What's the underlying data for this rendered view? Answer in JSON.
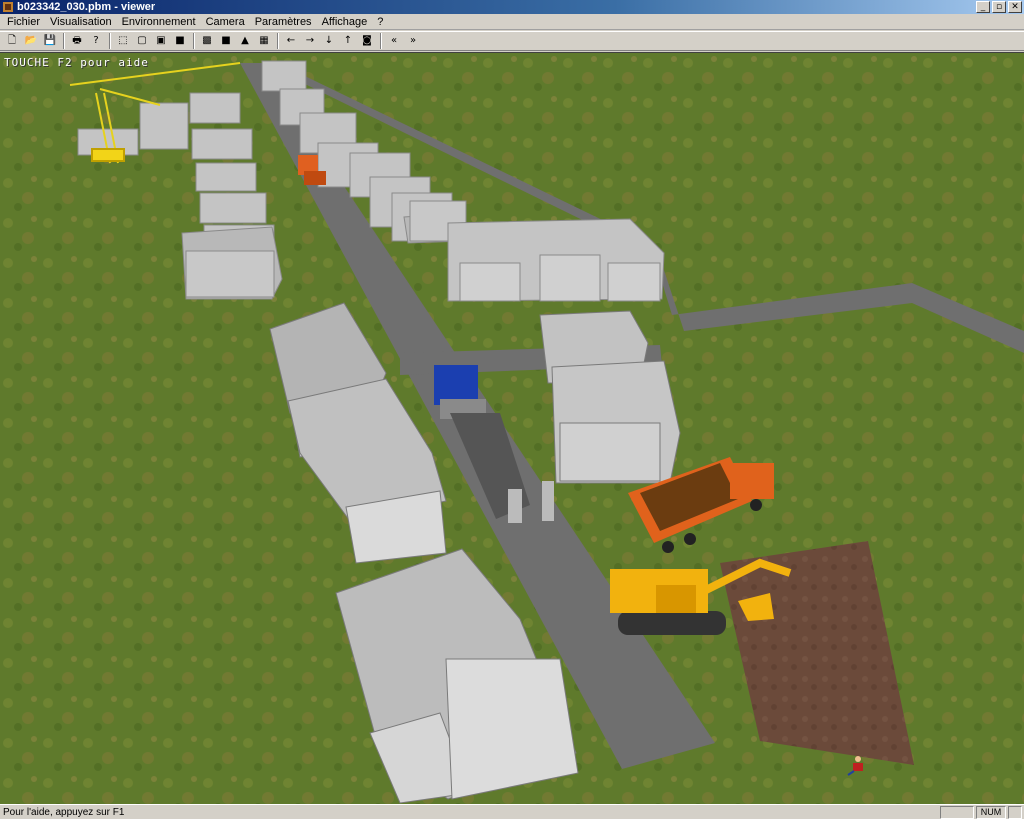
{
  "window": {
    "title": "b023342_030.pbm - viewer",
    "controls": {
      "minimize": "_",
      "maximize": "▫",
      "close": "✕"
    }
  },
  "menu": [
    "Fichier",
    "Visualisation",
    "Environnement",
    "Camera",
    "Paramètres",
    "Affichage",
    "?"
  ],
  "toolbar": {
    "groups": [
      [
        {
          "name": "new-file-icon",
          "glyph": "🗋"
        },
        {
          "name": "open-folder-icon",
          "glyph": "📂"
        },
        {
          "name": "save-disk-icon",
          "glyph": "💾"
        }
      ],
      [
        {
          "name": "print-icon",
          "glyph": "🖶"
        },
        {
          "name": "help-icon",
          "glyph": "?"
        }
      ],
      [
        {
          "name": "wireframe-cube-icon",
          "glyph": "⬚"
        },
        {
          "name": "outline-cube-icon",
          "glyph": "▢"
        },
        {
          "name": "flat-cube-icon",
          "glyph": "▣"
        },
        {
          "name": "shaded-cube-icon",
          "glyph": "■"
        }
      ],
      [
        {
          "name": "textured-cube-icon",
          "glyph": "▩"
        },
        {
          "name": "solid-cube-icon",
          "glyph": "■"
        },
        {
          "name": "triangle-icon",
          "glyph": "▲"
        },
        {
          "name": "grid-icon",
          "glyph": "▦"
        }
      ],
      [
        {
          "name": "arrow-left-icon",
          "glyph": "←"
        },
        {
          "name": "arrow-right-icon",
          "glyph": "→"
        },
        {
          "name": "arrow-down-icon",
          "glyph": "↓"
        },
        {
          "name": "arrow-up-icon",
          "glyph": "↑"
        },
        {
          "name": "camera-icon",
          "glyph": "◙"
        }
      ],
      [
        {
          "name": "rewind-icon",
          "glyph": "«"
        },
        {
          "name": "fast-forward-icon",
          "glyph": "»"
        }
      ]
    ]
  },
  "viewport": {
    "hint": "TOUCHE F2 pour aide",
    "colors": {
      "grass": "#5f7a2c",
      "road": "#6f6f6f",
      "wall": "#c6c6c6",
      "dirt": "#6b4a3a",
      "truck_cab": "#1b3fb0",
      "dumper": "#e0621c",
      "excavator": "#f2b20e"
    }
  },
  "status": {
    "text": "Pour l'aide, appuyez sur F1",
    "num": "NUM"
  }
}
